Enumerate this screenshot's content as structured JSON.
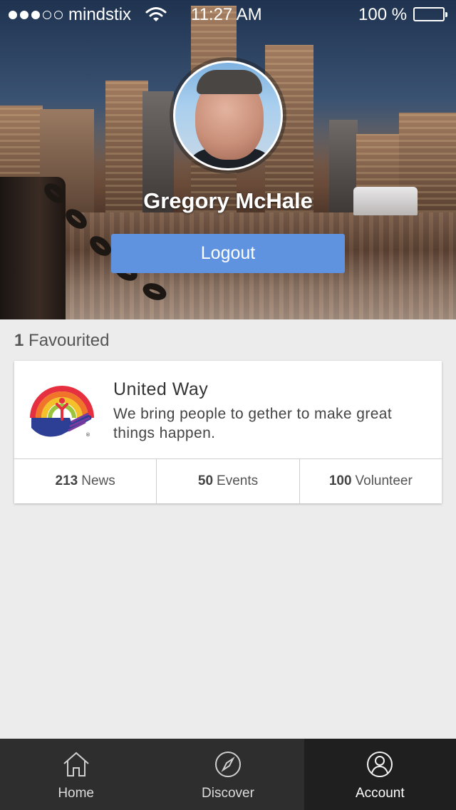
{
  "status_bar": {
    "signal_dots_filled": 3,
    "signal_dots_total": 5,
    "carrier": "mindstix",
    "time": "11:27 AM",
    "battery": "100 %",
    "battery_level": 1.0
  },
  "profile": {
    "name": "Gregory McHale",
    "logout_label": "Logout"
  },
  "favourites": {
    "count": "1",
    "label": "Favourited",
    "items": [
      {
        "name": "United Way",
        "description": "We bring people to gether to make great things happen.",
        "stats": [
          {
            "value": "213",
            "label": "News"
          },
          {
            "value": "50",
            "label": "Events"
          },
          {
            "value": "100",
            "label": "Volunteer"
          }
        ]
      }
    ]
  },
  "tabbar": {
    "tabs": [
      {
        "label": "Home",
        "icon": "home-icon",
        "active": false
      },
      {
        "label": "Discover",
        "icon": "compass-icon",
        "active": false
      },
      {
        "label": "Account",
        "icon": "user-icon",
        "active": true
      }
    ]
  },
  "colors": {
    "accent": "#5f93e0",
    "tabbar_bg": "#2e2e2e",
    "tabbar_active_bg": "#1f1f1f",
    "page_bg": "#ececec"
  }
}
